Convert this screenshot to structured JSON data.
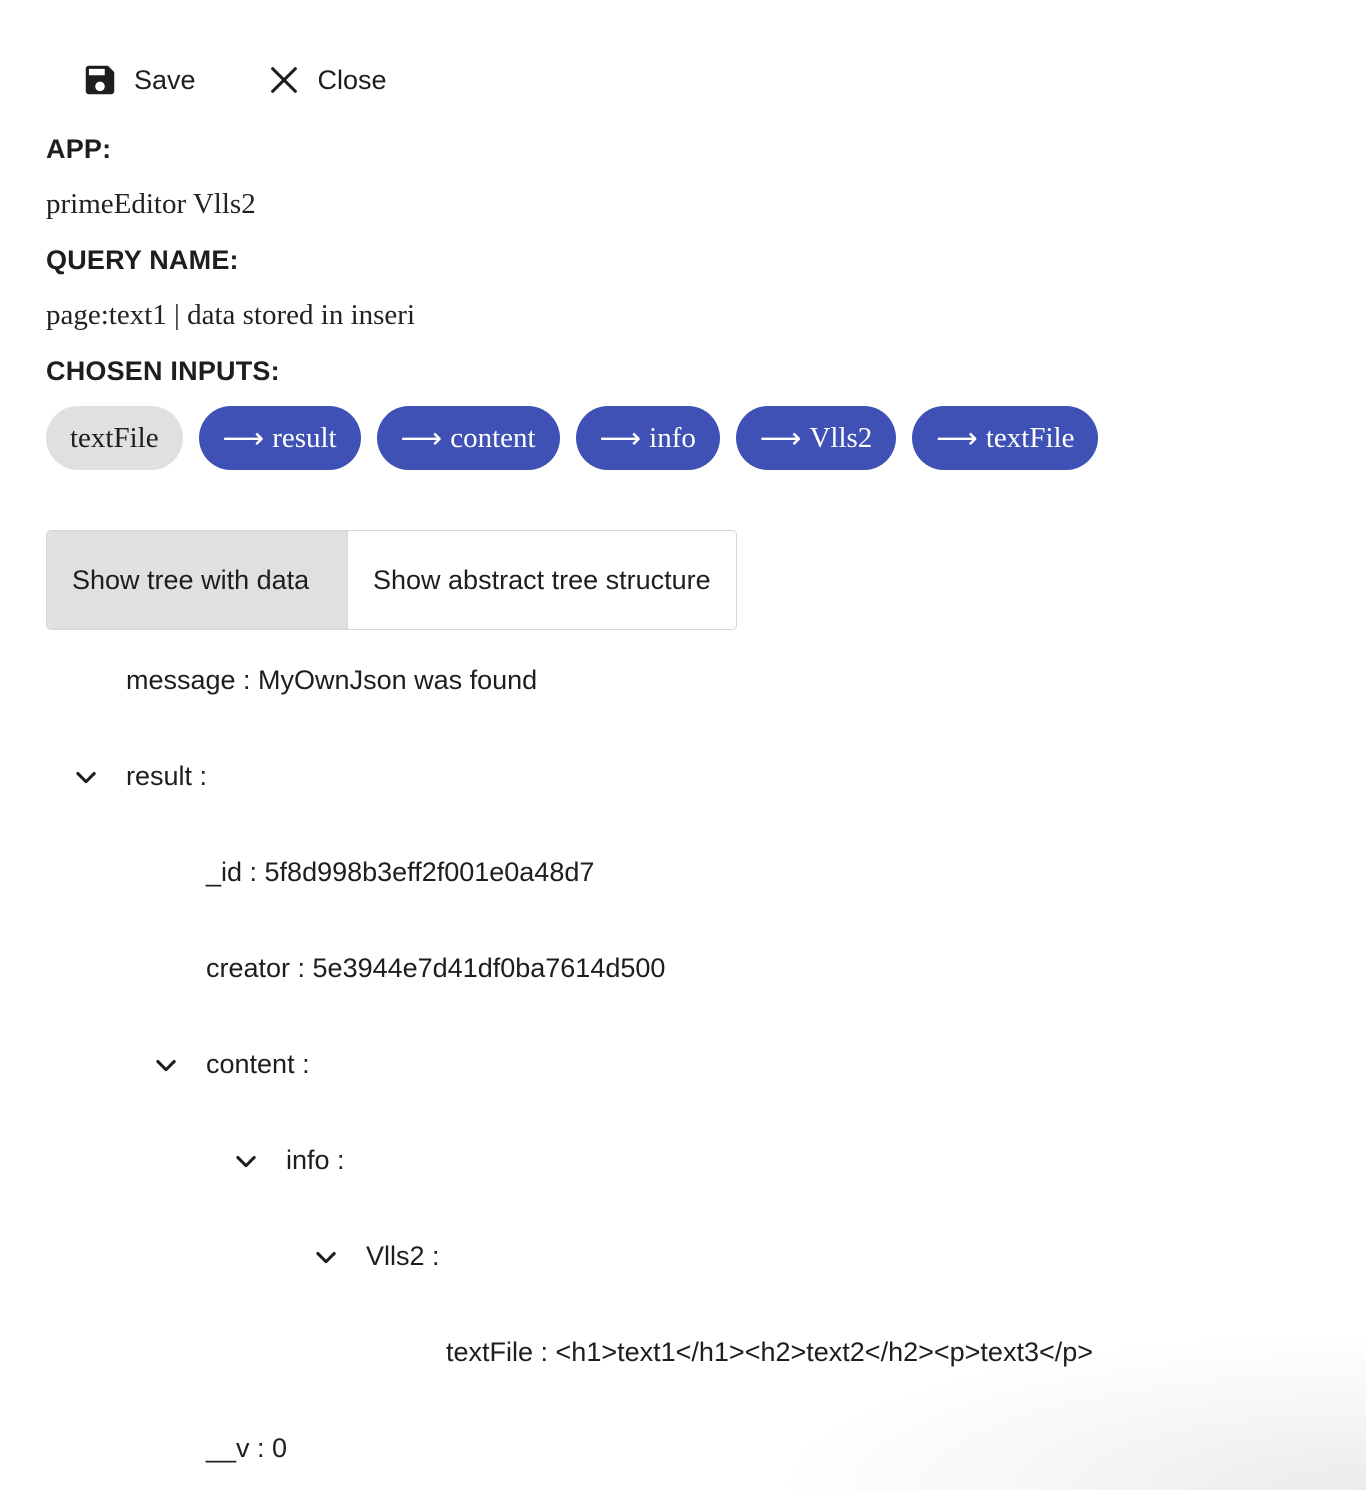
{
  "toolbar": {
    "save_label": "Save",
    "close_label": "Close"
  },
  "app": {
    "label": "APP:",
    "value": "primeEditor Vlls2"
  },
  "query": {
    "label": "QUERY NAME:",
    "value": "page:text1 | data stored in inseri"
  },
  "inputs": {
    "label": "CHOSEN INPUTS:",
    "root": "textFile",
    "arrow": "⟶",
    "path": [
      "result",
      "content",
      "info",
      "Vlls2",
      "textFile"
    ]
  },
  "view_toggle": {
    "with_data": "Show tree with data",
    "abstract": "Show abstract tree structure",
    "selected": "Show tree with data"
  },
  "tree": {
    "message": "message : MyOwnJson was found",
    "result": "result :",
    "id": "_id : 5f8d998b3eff2f001e0a48d7",
    "creator": "creator : 5e3944e7d41df0ba7614d500",
    "content": "content :",
    "info": "info :",
    "vlls2": "Vlls2 :",
    "textfile": "textFile : <h1>text1</h1><h2>text2</h2><p>text3</p>",
    "v": "__v : 0"
  },
  "colors": {
    "accent": "#3f51b5",
    "chip_root": "#e0e0e0",
    "toggle_active": "#e0e0e0",
    "text": "#1e1e1e"
  },
  "icons": {
    "save": "floppy-disk-icon",
    "close": "close-icon",
    "expand": "chevron-down-icon"
  }
}
